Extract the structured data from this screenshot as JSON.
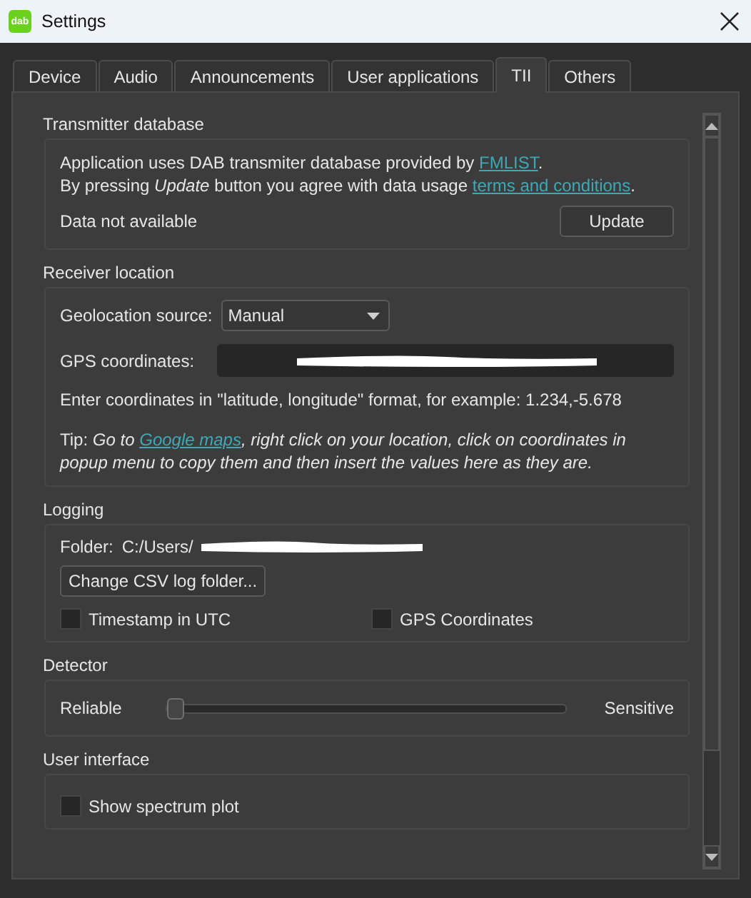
{
  "window": {
    "title": "Settings",
    "app_icon_text": "dab"
  },
  "tabs": [
    {
      "label": "Device",
      "selected": false
    },
    {
      "label": "Audio",
      "selected": false
    },
    {
      "label": "Announcements",
      "selected": false
    },
    {
      "label": "User applications",
      "selected": false
    },
    {
      "label": "TII",
      "selected": true
    },
    {
      "label": "Others",
      "selected": false
    }
  ],
  "transmitter_database": {
    "heading": "Transmitter database",
    "line_1": "Application uses DAB transmiter database provided by",
    "line_1_link": "FMLIST",
    "line_1_end": ".",
    "line_2": "By pressing *Update* button you agree with data usage",
    "line_2_link": "terms and conditions",
    "line_2_end": ".",
    "status": "Data not available",
    "button": "Update"
  },
  "receiver_location": {
    "heading": "Receiver location",
    "source_label": "Geolocation source:",
    "source_value": "Manual",
    "gps_label": "GPS coordinates:",
    "hint": "Enter coordinates in \"latitude, longitude\" format, for example: 1.234,-5.678",
    "tip_label": "Tip:",
    "tip_start": "Go to",
    "tip_link": "Google maps",
    "tip_end": ", right click on your location, click on coordinates in popup menu to copy them and then insert the values here as they are."
  },
  "logging": {
    "heading": "Logging",
    "folder_label": "Folder:",
    "folder_path": "C:/Users/",
    "button": "Change CSV log folder...",
    "checkboxes": [
      {
        "label": "Timestamp in UTC",
        "checked": false
      },
      {
        "label": "GPS Coordinates",
        "checked": false
      }
    ]
  },
  "detector": {
    "heading": "Detector",
    "min_label": "Reliable",
    "max_label": "Sensitive",
    "level": 0
  },
  "user_interface": {
    "heading": "User interface",
    "checkboxes": [
      {
        "label": "Show spectrum plot",
        "checked": false
      }
    ]
  }
}
